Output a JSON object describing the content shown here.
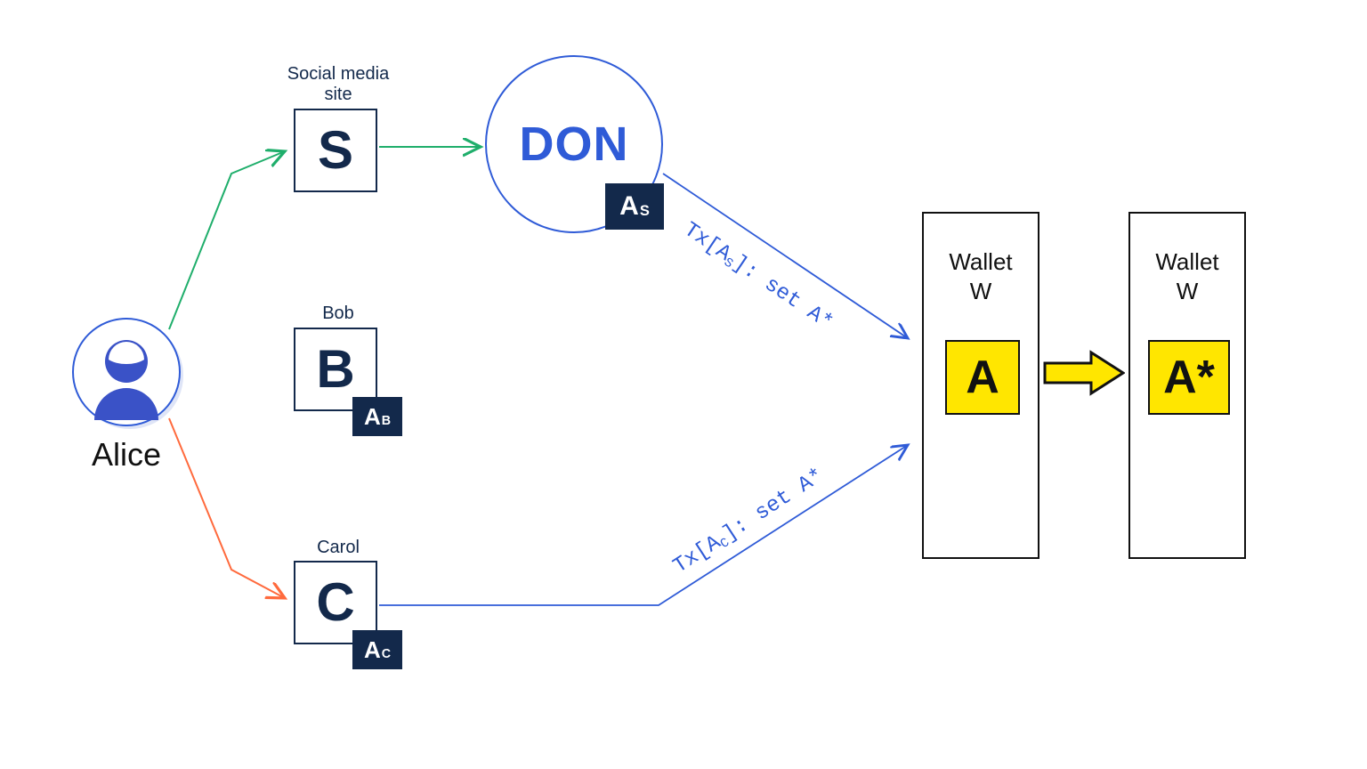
{
  "colors": {
    "navy": "#13294b",
    "blue": "#2f5bd7",
    "green": "#1fae6b",
    "orange": "#ff6a3d",
    "yellow": "#ffe600"
  },
  "alice": {
    "name": "Alice"
  },
  "nodes": {
    "social": {
      "caption_line1": "Social media",
      "caption_line2": "site",
      "letter": "S"
    },
    "bob": {
      "caption": "Bob",
      "letter": "B",
      "badge_main": "A",
      "badge_sub": "B"
    },
    "carol": {
      "caption": "Carol",
      "letter": "C",
      "badge_main": "A",
      "badge_sub": "C"
    }
  },
  "don": {
    "text": "DON",
    "badge_main": "A",
    "badge_sub": "S"
  },
  "tx": {
    "top": {
      "pre": "Tx[A",
      "sub": "S",
      "post": "]: set A*"
    },
    "bottom": {
      "pre": "Tx[A",
      "sub": "C",
      "post": "]: set A*"
    }
  },
  "wallets": {
    "left": {
      "title": "Wallet",
      "name": "W",
      "chip": "A"
    },
    "right": {
      "title": "Wallet",
      "name": "W",
      "chip": "A*"
    }
  }
}
